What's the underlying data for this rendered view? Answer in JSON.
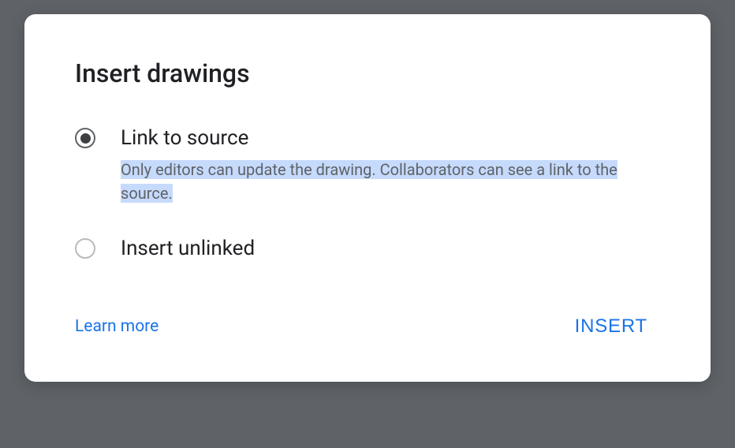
{
  "dialog": {
    "title": "Insert drawings",
    "options": [
      {
        "label": "Link to source",
        "description": "Only editors can update the drawing. Collaborators can see a link to the source.",
        "selected": true
      },
      {
        "label": "Insert unlinked",
        "description": "",
        "selected": false
      }
    ],
    "learn_more": "Learn more",
    "insert_button": "INSERT"
  }
}
